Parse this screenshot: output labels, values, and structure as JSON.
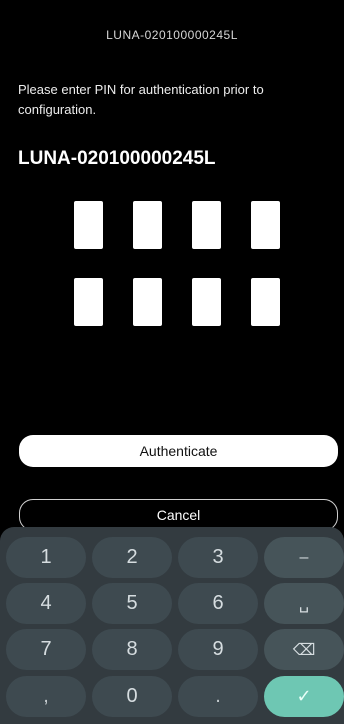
{
  "header": {
    "title": "LUNA-020100000245L"
  },
  "prompt": {
    "text": "Please enter PIN for authentication prior to configuration."
  },
  "device": {
    "name": "LUNA-020100000245L"
  },
  "pin": {
    "length": 8,
    "values": [
      "",
      "",
      "",
      "",
      "",
      "",
      "",
      ""
    ]
  },
  "buttons": {
    "authenticate": "Authenticate",
    "cancel": "Cancel"
  },
  "keyboard": {
    "rows": [
      [
        "1",
        "2",
        "3",
        "–"
      ],
      [
        "4",
        "5",
        "6",
        "␣"
      ],
      [
        "7",
        "8",
        "9",
        "⌫"
      ],
      [
        ",",
        "0",
        ".",
        "✓"
      ]
    ],
    "icons": {
      "dash": "minus-icon",
      "space": "space-icon",
      "backspace": "backspace-icon",
      "enter": "check-icon"
    },
    "accent_color": "#6ec7b3"
  }
}
